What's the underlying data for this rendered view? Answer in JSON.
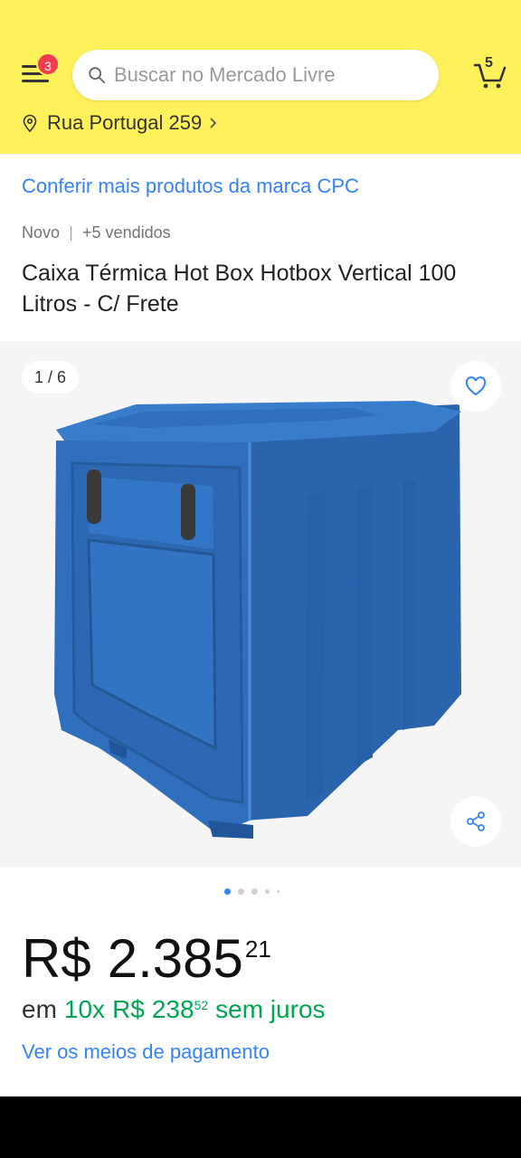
{
  "header": {
    "notification_count": "3",
    "search_placeholder": "Buscar no Mercado Livre",
    "cart_count": "5",
    "location": "Rua Portugal 259"
  },
  "product": {
    "brand_link": "Conferir mais produtos da marca CPC",
    "condition": "Novo",
    "sold": "+5 vendidos",
    "title": "Caixa Térmica Hot Box Hotbox Vertical 100 Litros - C/ Frete",
    "image_counter": "1 / 6"
  },
  "price": {
    "currency": "R$",
    "amount": "2.385",
    "cents": "21"
  },
  "installments": {
    "prefix": "em",
    "count": "10x",
    "currency": "R$",
    "amount": "238",
    "cents": "52",
    "suffix": "sem juros"
  },
  "payment_link": "Ver os meios de pagamento",
  "colors": {
    "header_bg": "#fff159",
    "link_blue": "#3483fa",
    "green": "#00a650",
    "badge_red": "#f23d4f",
    "product_blue": "#2f6fbd"
  }
}
